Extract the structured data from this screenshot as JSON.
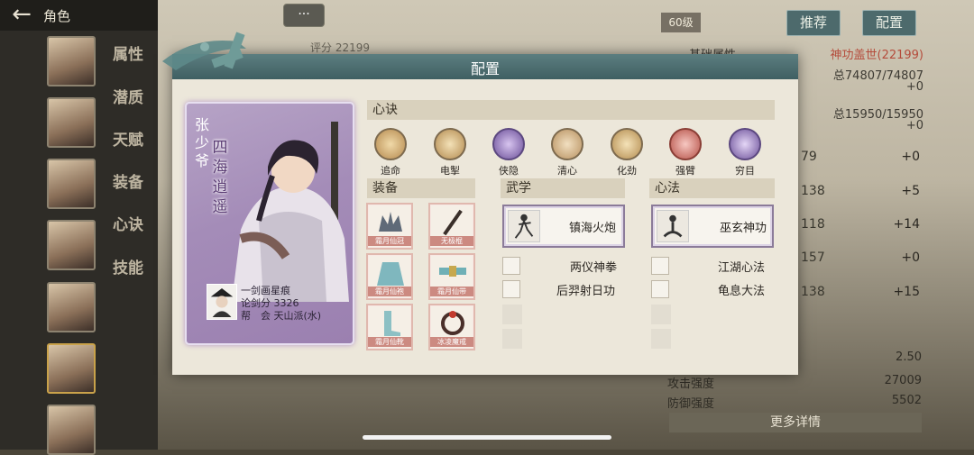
{
  "header": {
    "back_title": "角色"
  },
  "side_tabs": [
    "属性",
    "潜质",
    "天赋",
    "装备",
    "心诀",
    "技能"
  ],
  "background": {
    "chat_button": "···",
    "score": "评分 22199",
    "level": "60级",
    "recommend_button": "推荐",
    "config_button": "配置",
    "base_attr_label": "基础属性",
    "martial_label": "神功盖世(22199)",
    "hp": "总74807/74807",
    "hp_plus": "+0",
    "mp": "总15950/15950",
    "mp_plus": "+0",
    "stats": [
      {
        "value": "79",
        "plus": "+0"
      },
      {
        "value": "138",
        "plus": "+5"
      },
      {
        "value": "118",
        "plus": "+14"
      },
      {
        "value": "157",
        "plus": "+0"
      },
      {
        "value": "138",
        "plus": "+15"
      }
    ],
    "bottom_stats": [
      {
        "label": "",
        "value": "2.50"
      },
      {
        "label": "攻击强度",
        "value": "27009"
      },
      {
        "label": "防御强度",
        "value": "5502"
      }
    ],
    "more_details": "更多详情"
  },
  "dialog": {
    "title": "配置",
    "card": {
      "name": "张少爷",
      "title": "四海逍遥",
      "line1": "一剑画星痕",
      "line2": "论剑分 3326",
      "line3": "帮　会 天山派(水)"
    },
    "xinjue_header": "心诀",
    "xinjue": [
      "追命",
      "电掣",
      "侠隐",
      "清心",
      "化劲",
      "强臂",
      "穷目"
    ],
    "equip_header": "装备",
    "equip_items": [
      "霜月仙冠",
      "无极棍",
      "霜月仙袍",
      "霜月仙带",
      "霜月仙靴",
      "冰凌魔戒"
    ],
    "wuxue_header": "武学",
    "wuxue_main": "镇海火炮",
    "wuxue_list": [
      "两仪神拳",
      "后羿射日功"
    ],
    "xinfa_header": "心法",
    "xinfa_main": "巫玄神功",
    "xinfa_list": [
      "江湖心法",
      "龟息大法"
    ]
  }
}
